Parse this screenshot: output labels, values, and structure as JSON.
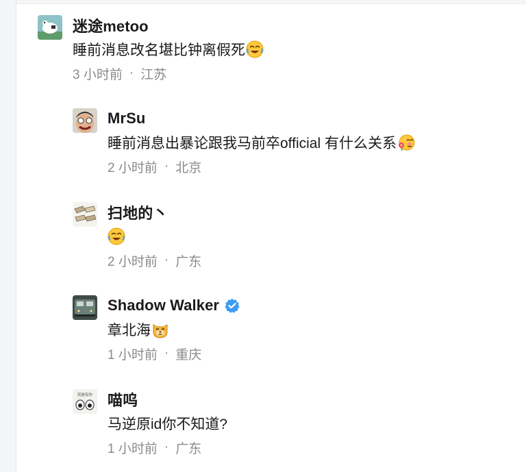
{
  "comments": [
    {
      "name": "迷途metoo",
      "text": "睡前消息改名堪比钟离假死",
      "emoji": "laughing-crying-emoji",
      "time": "3 小时前",
      "location": "江苏",
      "avatar": "white-dog-avatar"
    },
    {
      "name": "MrSu",
      "text": "睡前消息出暴论跟我马前卒official 有什么关系",
      "emoji": "blushing-flower-emoji",
      "time": "2 小时前",
      "location": "北京",
      "avatar": "laughing-man-avatar"
    },
    {
      "name": "扫地的丶",
      "text": "",
      "emoji": "laughing-crying-emoji",
      "time": "2 小时前",
      "location": "广东",
      "avatar": "comic-strip-avatar"
    },
    {
      "name": "Shadow Walker",
      "text": "章北海",
      "emoji": "smug-dog-emoji",
      "time": "1 小时前",
      "location": "重庆",
      "avatar": "train-avatar",
      "verified": true
    },
    {
      "name": "喵呜",
      "text": "马逆原id你不知道?",
      "emoji": "",
      "time": "1 小时前",
      "location": "广东",
      "avatar": "cartoon-eyes-avatar",
      "avatar_caption": "就是有你"
    }
  ],
  "meta_separator": "·",
  "colors": {
    "name": "#1a1a1a",
    "meta": "#8a8a8a",
    "verified": "#3d9df5",
    "emoji_yellow": "#ffc83d"
  }
}
